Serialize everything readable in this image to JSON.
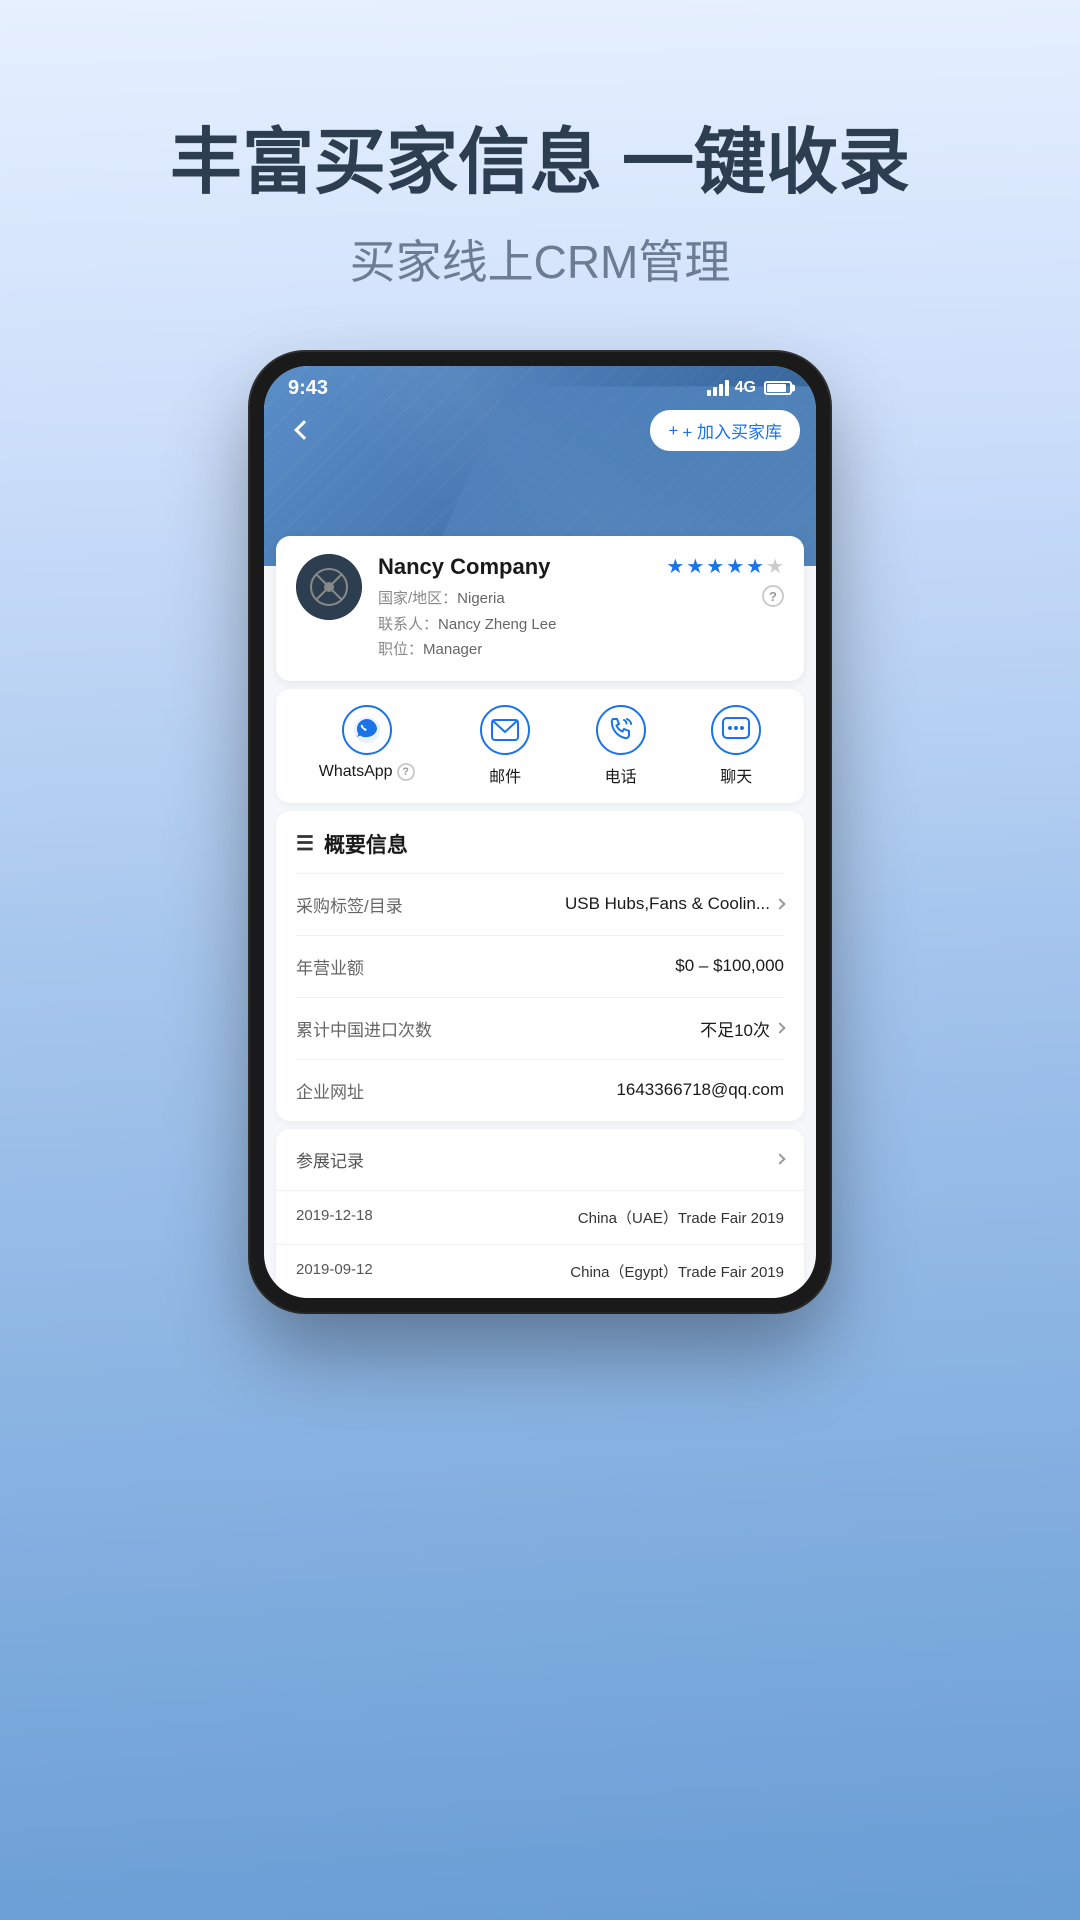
{
  "page": {
    "headline": "丰富买家信息 一键收录",
    "subtitle": "买家线上CRM管理"
  },
  "phone": {
    "statusBar": {
      "time": "9:43",
      "signal": "4G"
    },
    "addBuyerBtn": "+ 加入买家库",
    "company": {
      "name": "Nancy Company",
      "countryLabel": "国家/地区：",
      "country": "Nigeria",
      "contactLabel": "联系人：",
      "contact": "Nancy Zheng Lee",
      "positionLabel": "职位：",
      "position": "Manager",
      "stars": 5
    },
    "actions": [
      {
        "id": "whatsapp",
        "label": "WhatsApp",
        "hasHelp": true
      },
      {
        "id": "email",
        "label": "邮件",
        "hasHelp": false
      },
      {
        "id": "phone",
        "label": "电话",
        "hasHelp": false
      },
      {
        "id": "chat",
        "label": "聊天",
        "hasHelp": false
      }
    ],
    "infoSection": {
      "title": "概要信息",
      "rows": [
        {
          "label": "采购标签/目录",
          "value": "USB Hubs,Fans & Coolin...",
          "hasChevron": true
        },
        {
          "label": "年营业额",
          "value": "$0 – $100,000",
          "hasChevron": false
        },
        {
          "label": "累计中国进口次数",
          "value": "不足10次",
          "hasChevron": true
        },
        {
          "label": "企业网址",
          "value": "1643366718@qq.com",
          "hasChevron": false
        }
      ]
    },
    "tradeSection": {
      "headerLabel": "参展记录",
      "rows": [
        {
          "date": "2019-12-18",
          "name": "China（UAE）Trade Fair 2019"
        },
        {
          "date": "2019-09-12",
          "name": "China（Egypt）Trade Fair 2019"
        }
      ]
    }
  }
}
